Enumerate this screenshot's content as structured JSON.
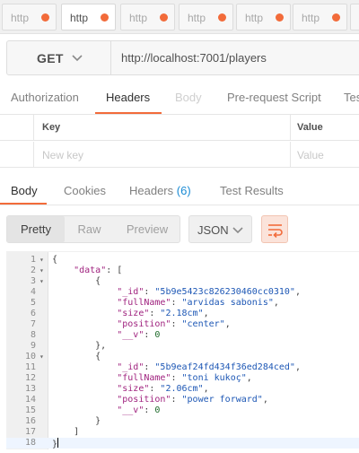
{
  "tabs": [
    {
      "label": "http",
      "active": false
    },
    {
      "label": "http",
      "active": true
    },
    {
      "label": "http",
      "active": false
    },
    {
      "label": "http",
      "active": false
    },
    {
      "label": "http",
      "active": false
    },
    {
      "label": "http",
      "active": false
    },
    {
      "label": "http",
      "active": false
    }
  ],
  "request": {
    "method": "GET",
    "url": "http://localhost:7001/players"
  },
  "request_tabs": {
    "authorization": "Authorization",
    "headers": "Headers",
    "body": "Body",
    "prerequest": "Pre-request Script",
    "tests": "Tests"
  },
  "headers_table": {
    "col_key": "Key",
    "col_value": "Value",
    "placeholder_key": "New key",
    "placeholder_value": "Value"
  },
  "response_tabs": {
    "body": "Body",
    "cookies": "Cookies",
    "headers": "Headers",
    "headers_count": "(6)",
    "test_results": "Test Results"
  },
  "response_toolbar": {
    "pretty": "Pretty",
    "raw": "Raw",
    "preview": "Preview",
    "format": "JSON"
  },
  "colors": {
    "accent": "#f26b3a",
    "link_count": "#1a8bd4"
  },
  "code_lines": [
    "{",
    "    \"data\": [",
    "        {",
    "            \"_id\": \"5b9e5423c826230460cc0310\",",
    "            \"fullName\": \"arvidas sabonis\",",
    "            \"size\": \"2.18cm\",",
    "            \"position\": \"center\",",
    "            \"__v\": 0",
    "        },",
    "        {",
    "            \"_id\": \"5b9eaf24fd434f36ed284ced\",",
    "            \"fullName\": \"toni kukoç\",",
    "            \"size\": \"2.06cm\",",
    "            \"position\": \"power forward\",",
    "            \"__v\": 0",
    "        }",
    "    ]",
    "}"
  ]
}
